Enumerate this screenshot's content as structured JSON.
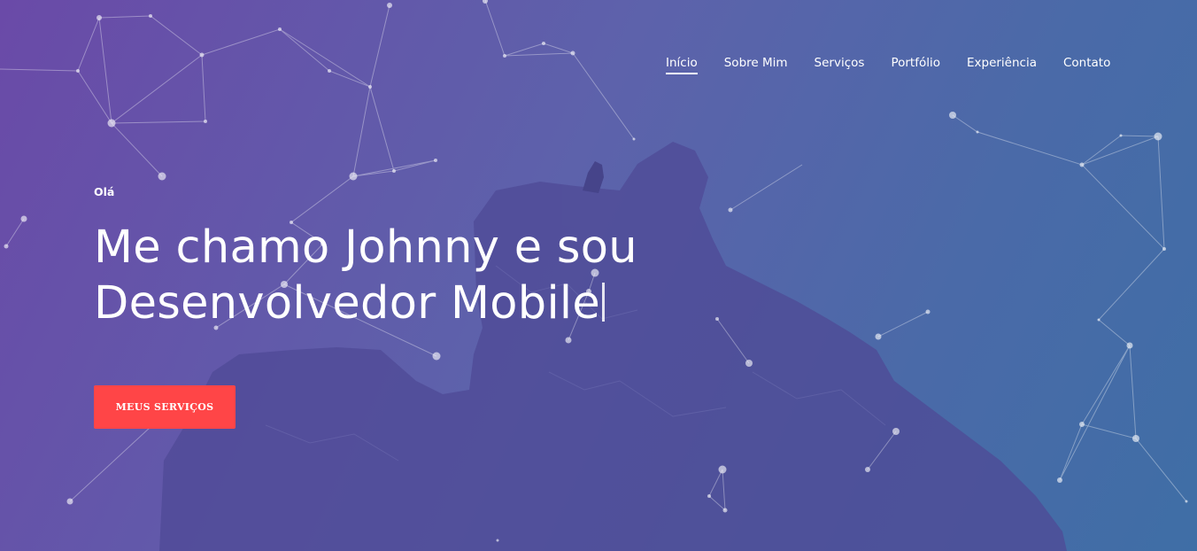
{
  "nav": {
    "items": [
      {
        "label": "Início",
        "active": true
      },
      {
        "label": "Sobre Mim",
        "active": false
      },
      {
        "label": "Serviços",
        "active": false
      },
      {
        "label": "Portfólio",
        "active": false
      },
      {
        "label": "Experiência",
        "active": false
      },
      {
        "label": "Contato",
        "active": false
      }
    ]
  },
  "hero": {
    "greeting": "Olá",
    "headline_line1": "Me chamo Johnny e sou",
    "headline_line2": "Desenvolvedor Mobile",
    "cta_label": "MEUS SERVIÇOS"
  },
  "colors": {
    "accent": "#ff4547",
    "text": "#ffffff",
    "background_start": "#6a4aa8",
    "background_end": "#3f6ea6"
  }
}
